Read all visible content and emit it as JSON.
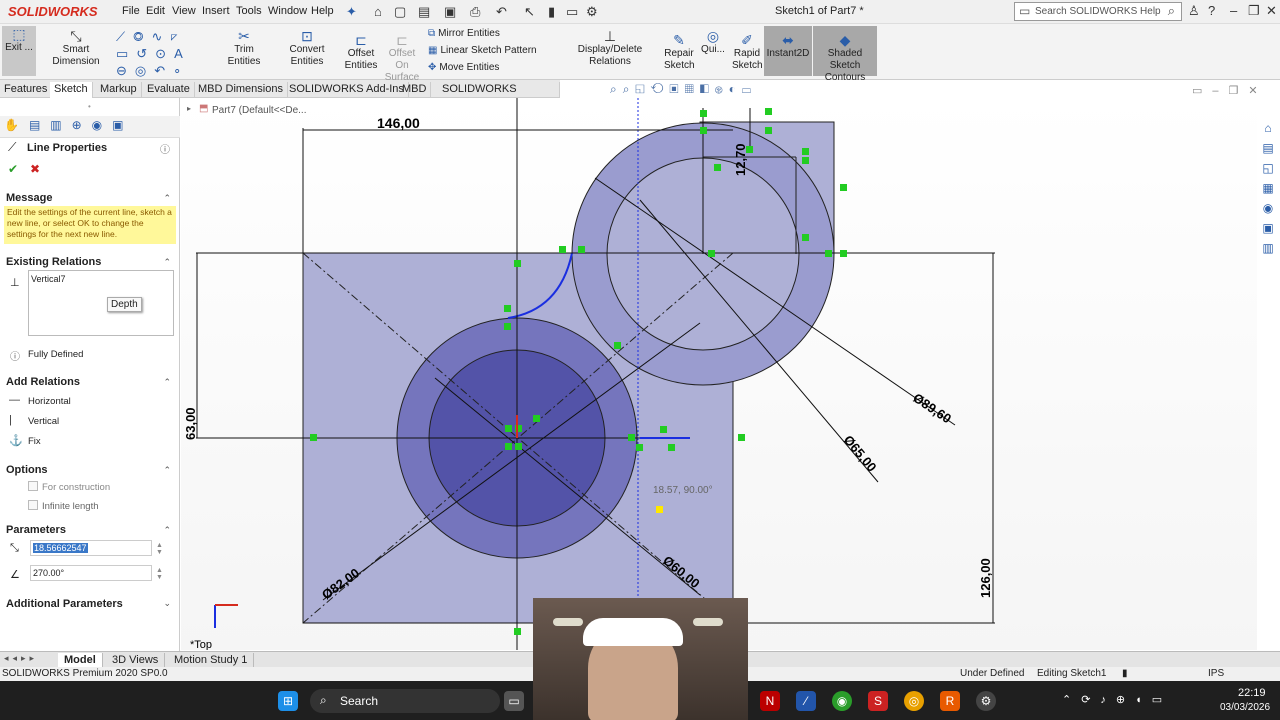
{
  "app": {
    "logo": "SOLIDWORKS",
    "window_title": "Sketch1 of Part7 *"
  },
  "menu": [
    "File",
    "Edit",
    "View",
    "Insert",
    "Tools",
    "Window",
    "Help"
  ],
  "search": {
    "placeholder": "Search SOLIDWORKS Help"
  },
  "commands": {
    "exit": "Exit ...",
    "smart_dimension": "Smart Dimension",
    "trim": "Trim Entities",
    "convert": "Convert Entities",
    "offset": "Offset Entities",
    "offset_surface": "Offset On Surface",
    "mirror": "Mirror Entities",
    "linear_pattern": "Linear Sketch Pattern",
    "move": "Move Entities",
    "display_delete": "Display/Delete Relations",
    "repair": "Repair Sketch",
    "quick": "Qui...",
    "rapid": "Rapid Sketch",
    "instant2d": "Instant2D",
    "shaded": "Shaded Sketch Contours"
  },
  "tabs": [
    "Features",
    "Sketch",
    "Markup",
    "Evaluate",
    "MBD Dimensions",
    "SOLIDWORKS Add-Ins",
    "MBD",
    "SOLIDWORKS Inspection"
  ],
  "active_tab": "Sketch",
  "tree": {
    "part": "Part7  (Default<<De..."
  },
  "panel": {
    "title": "Line Properties",
    "message_header": "Message",
    "message": "Edit the settings of the current line, sketch a new line, or select OK to change the settings for the next new line.",
    "existing_header": "Existing Relations",
    "existing_relation": "Vertical7",
    "tooltip": "Depth",
    "status": "Fully Defined",
    "add_header": "Add Relations",
    "add_items": [
      "Horizontal",
      "Vertical",
      "Fix"
    ],
    "options_header": "Options",
    "options": [
      "For construction",
      "Infinite length"
    ],
    "params_header": "Parameters",
    "length": "18.56662547",
    "angle": "270.00°",
    "additional_header": "Additional Parameters"
  },
  "dimensions": {
    "d146": "146,00",
    "d1270": "12,70",
    "d63": "63,00",
    "d126": "126,00",
    "dia8960": "Ø89,60",
    "dia6500": "Ø65,00",
    "dia8200": "Ø82,00",
    "dia6000": "Ø60,00",
    "cursor": "18.57, 90.00°"
  },
  "view_label": "*Top",
  "bottom_tabs": [
    "Model",
    "3D Views",
    "Motion Study 1"
  ],
  "status_bar": {
    "left": "SOLIDWORKS Premium 2020 SP0.0",
    "state": "Under Defined",
    "editing": "Editing Sketch1",
    "units": "IPS"
  },
  "taskbar": {
    "search": "Search",
    "time": "22:19",
    "date": "03/03/2026"
  },
  "colors": {
    "fill": "#aeb0d6",
    "dark_fill": "#5b5ba8",
    "handle": "#22cc22",
    "accent": "#d52b1e"
  }
}
